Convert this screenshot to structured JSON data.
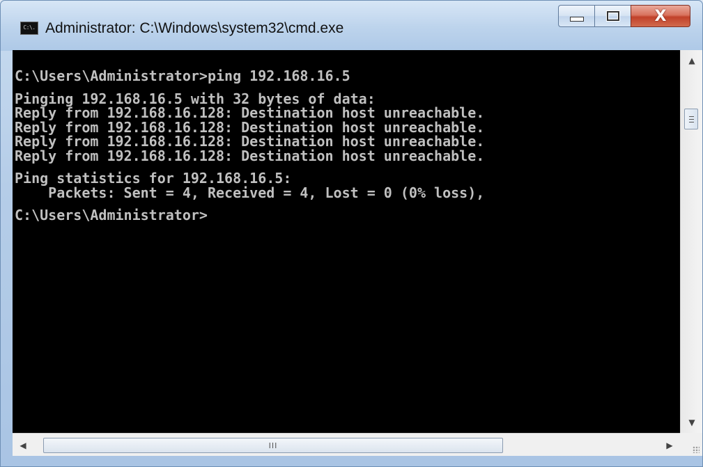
{
  "window": {
    "title": "Administrator: C:\\Windows\\system32\\cmd.exe",
    "icon_text": "C:\\."
  },
  "console": {
    "lines": [
      "C:\\Users\\Administrator>ping 192.168.16.5",
      "",
      "Pinging 192.168.16.5 with 32 bytes of data:",
      "Reply from 192.168.16.128: Destination host unreachable.",
      "Reply from 192.168.16.128: Destination host unreachable.",
      "Reply from 192.168.16.128: Destination host unreachable.",
      "Reply from 192.168.16.128: Destination host unreachable.",
      "",
      "Ping statistics for 192.168.16.5:",
      "    Packets: Sent = 4, Received = 4, Lost = 0 (0% loss),",
      "",
      "C:\\Users\\Administrator>"
    ]
  },
  "scrollbars": {
    "hthumb_grip": "III",
    "close_glyph": "X",
    "vertical_position": 0.14,
    "horizontal_position": 0.0
  },
  "colors": {
    "console_background": "#000000",
    "console_text": "#c0c0c0",
    "close_button": "#c1412a"
  }
}
